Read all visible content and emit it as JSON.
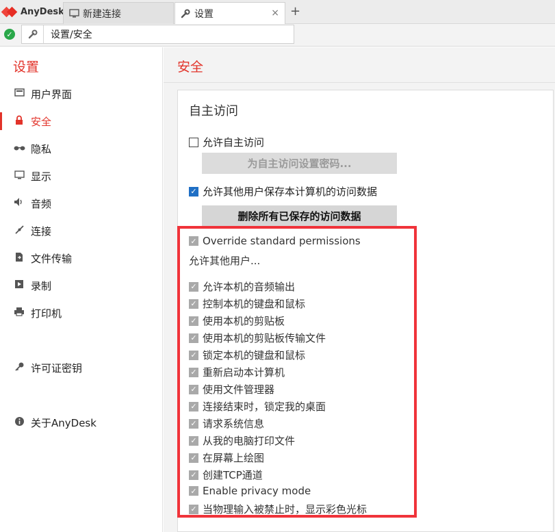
{
  "app": {
    "name": "AnyDesk"
  },
  "tabs": [
    {
      "label": "新建连接",
      "icon": "monitor-icon"
    },
    {
      "label": "设置",
      "icon": "wrench-icon",
      "close": "×"
    }
  ],
  "tab_add": "+",
  "address": {
    "path": "设置/安全"
  },
  "sidebar": {
    "title": "设置",
    "items": [
      {
        "label": "用户界面",
        "icon": "▭"
      },
      {
        "label": "安全",
        "icon": "🔒"
      },
      {
        "label": "隐私",
        "icon": "●●"
      },
      {
        "label": "显示",
        "icon": "▢"
      },
      {
        "label": "音频",
        "icon": "🔈"
      },
      {
        "label": "连接",
        "icon": "✎"
      },
      {
        "label": "文件传输",
        "icon": "⇄"
      },
      {
        "label": "录制",
        "icon": "▶"
      },
      {
        "label": "打印机",
        "icon": "⎙"
      },
      {
        "label": "许可证密钥",
        "icon": "⚷"
      },
      {
        "label": "关于AnyDesk",
        "icon": "ⓘ"
      }
    ]
  },
  "main": {
    "title": "安全",
    "section_title": "自主访问",
    "allow_unattended": "允许自主访问",
    "set_password_btn": "为自主访问设置密码...",
    "allow_save_data": "允许其他用户保存本计算机的访问数据",
    "delete_data_btn": "删除所有已保存的访问数据",
    "override": "Override standard permissions",
    "allow_others_label": "允许其他用户...",
    "permissions": [
      "允许本机的音频输出",
      "控制本机的键盘和鼠标",
      "使用本机的剪贴板",
      "使用本机的剪贴板传输文件",
      "锁定本机的键盘和鼠标",
      "重新启动本计算机",
      "使用文件管理器",
      "连接结束时，锁定我的桌面",
      "请求系统信息",
      "从我的电脑打印文件",
      "在屏幕上绘图",
      "创建TCP通道",
      "Enable privacy mode",
      "当物理输入被禁止时，显示彩色光标"
    ]
  },
  "colors": {
    "accent": "#e2332a",
    "highlight": "#f0333a",
    "check": "#1f6fc5"
  }
}
